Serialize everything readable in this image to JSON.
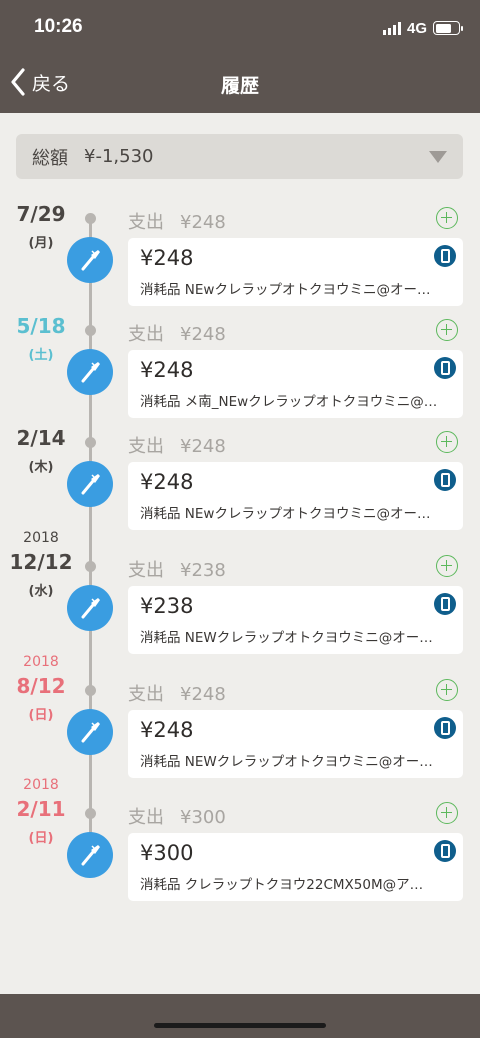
{
  "status": {
    "time": "10:26",
    "network": "4G"
  },
  "header": {
    "back_label": "戻る",
    "title": "履歴"
  },
  "total": {
    "label": "総額",
    "value": "¥-1,530"
  },
  "colors": {
    "header": "#5c5450",
    "accent": "#3a9de1",
    "plus": "#5cb85c",
    "saturday": "#5bbfd0",
    "holiday": "#e8707a",
    "default_date": "#4a4643"
  },
  "entries": [
    {
      "year": "",
      "date": "7/29",
      "dow": "(月)",
      "date_color": "#4a4643",
      "type": "支出",
      "summary_amount": "¥248",
      "amount": "¥248",
      "desc": "消耗品 NEwクレラップオトクヨウミニ@オー…"
    },
    {
      "year": "",
      "date": "5/18",
      "dow": "(土)",
      "date_color": "#5bbfd0",
      "type": "支出",
      "summary_amount": "¥248",
      "amount": "¥248",
      "desc": "消耗品 メ南_NEwクレラップオトクヨウミニ@…"
    },
    {
      "year": "",
      "date": "2/14",
      "dow": "(木)",
      "date_color": "#4a4643",
      "type": "支出",
      "summary_amount": "¥248",
      "amount": "¥248",
      "desc": "消耗品 NEwクレラップオトクヨウミニ@オー…"
    },
    {
      "year": "2018",
      "date": "12/12",
      "dow": "(水)",
      "date_color": "#4a4643",
      "type": "支出",
      "summary_amount": "¥238",
      "amount": "¥238",
      "desc": "消耗品 NEWクレラップオトクヨウミニ@オー…"
    },
    {
      "year": "2018",
      "date": "8/12",
      "dow": "(日)",
      "date_color": "#e8707a",
      "type": "支出",
      "summary_amount": "¥248",
      "amount": "¥248",
      "desc": "消耗品 NEWクレラップオトクヨウミニ@オー…"
    },
    {
      "year": "2018",
      "date": "2/11",
      "dow": "(日)",
      "date_color": "#e8707a",
      "type": "支出",
      "summary_amount": "¥300",
      "amount": "¥300",
      "desc": "消耗品 クレラップトクヨウ22CMX50M@ア…"
    }
  ]
}
